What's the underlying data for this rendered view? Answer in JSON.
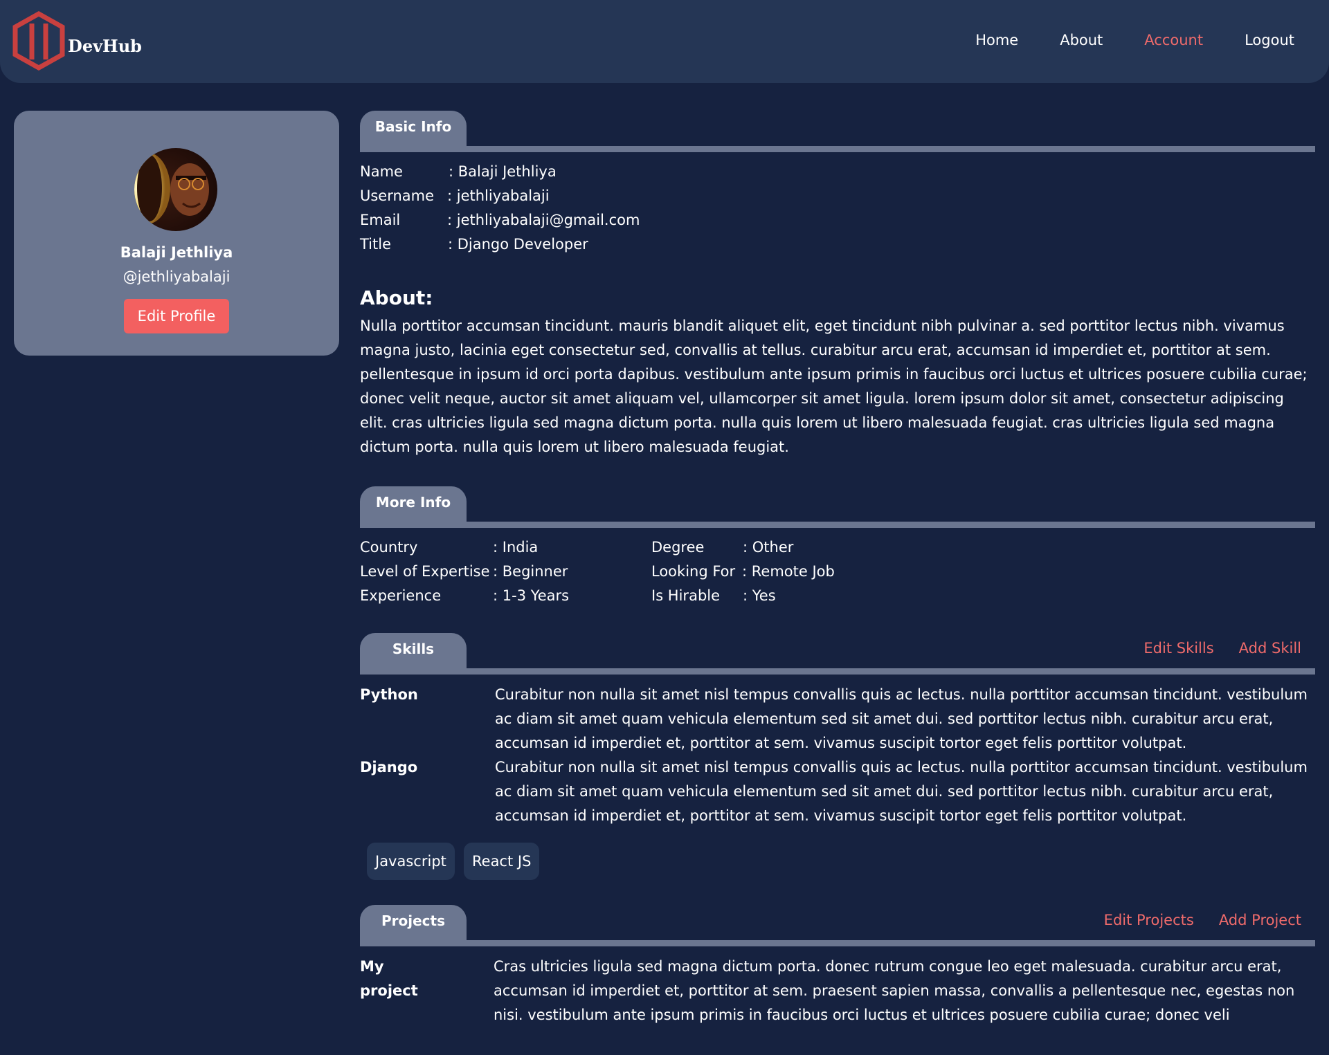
{
  "brand": {
    "name": "DevHub",
    "accent": "#f06b6b"
  },
  "nav": {
    "items": [
      {
        "label": "Home"
      },
      {
        "label": "About"
      },
      {
        "label": "Account"
      },
      {
        "label": "Logout"
      }
    ]
  },
  "profile": {
    "name": "Balaji Jethliya",
    "username": "@jethliyabalaji",
    "edit_label": "Edit Profile"
  },
  "basic_info": {
    "tab": "Basic Info",
    "rows": [
      {
        "key": "Name",
        "value": ": Balaji Jethliya"
      },
      {
        "key": "Username",
        "value": ": jethliyabalaji"
      },
      {
        "key": "Email",
        "value": ": jethliyabalaji@gmail.com"
      },
      {
        "key": "Title",
        "value": ": Django Developer"
      }
    ]
  },
  "about": {
    "title": "About:",
    "text": "Nulla porttitor accumsan tincidunt. mauris blandit aliquet elit, eget tincidunt nibh pulvinar a. sed porttitor lectus nibh. vivamus magna justo, lacinia eget consectetur sed, convallis at tellus. curabitur arcu erat, accumsan id imperdiet et, porttitor at sem. pellentesque in ipsum id orci porta dapibus. vestibulum ante ipsum primis in faucibus orci luctus et ultrices posuere cubilia curae; donec velit neque, auctor sit amet aliquam vel, ullamcorper sit amet ligula. lorem ipsum dolor sit amet, consectetur adipiscing elit. cras ultricies ligula sed magna dictum porta. nulla quis lorem ut libero malesuada feugiat. cras ultricies ligula sed magna dictum porta. nulla quis lorem ut libero malesuada feugiat."
  },
  "more_info": {
    "tab": "More Info",
    "left": [
      {
        "key": "Country",
        "value": ": India"
      },
      {
        "key": "Level of Expertise",
        "value": ": Beginner"
      },
      {
        "key": "Experience",
        "value": ": 1-3 Years"
      }
    ],
    "right": [
      {
        "key": "Degree",
        "value": ": Other"
      },
      {
        "key": "Looking For",
        "value": ": Remote Job"
      },
      {
        "key": "Is Hirable",
        "value": ": Yes"
      }
    ]
  },
  "skills": {
    "tab": "Skills",
    "edit_label": "Edit Skills",
    "add_label": "Add Skill",
    "items": [
      {
        "name": "Python",
        "description": "Curabitur non nulla sit amet nisl tempus convallis quis ac lectus. nulla porttitor accumsan tincidunt. vestibulum ac diam sit amet quam vehicula elementum sed sit amet dui. sed porttitor lectus nibh. curabitur arcu erat, accumsan id imperdiet et, porttitor at sem. vivamus suscipit tortor eget felis porttitor volutpat."
      },
      {
        "name": "Django",
        "description": "Curabitur non nulla sit amet nisl tempus convallis quis ac lectus. nulla porttitor accumsan tincidunt. vestibulum ac diam sit amet quam vehicula elementum sed sit amet dui. sed porttitor lectus nibh. curabitur arcu erat, accumsan id imperdiet et, porttitor at sem. vivamus suscipit tortor eget felis porttitor volutpat."
      }
    ],
    "tags": [
      "Javascript",
      "React JS"
    ]
  },
  "projects": {
    "tab": "Projects",
    "edit_label": "Edit Projects",
    "add_label": "Add Project",
    "items": [
      {
        "name": "My project",
        "description": "Cras ultricies ligula sed magna dictum porta. donec rutrum congue leo eget malesuada. curabitur arcu erat, accumsan id imperdiet et, porttitor at sem. praesent sapien massa, convallis a pellentesque nec, egestas non nisi. vestibulum ante ipsum primis in faucibus orci luctus et ultrices posuere cubilia curae; donec veli"
      }
    ]
  }
}
